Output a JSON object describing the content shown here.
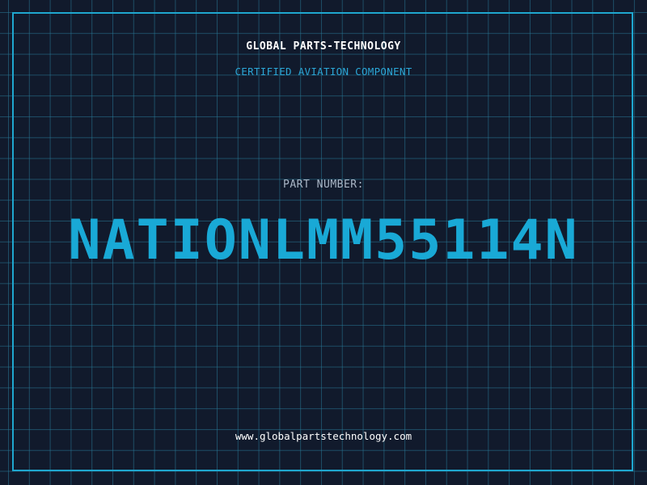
{
  "header": {
    "company_name": "GLOBAL PARTS-TECHNOLOGY",
    "tagline": "CERTIFIED AVIATION COMPONENT"
  },
  "part": {
    "label": "PART NUMBER:",
    "number": "NATIONLMM55114N"
  },
  "footer": {
    "website": "www.globalpartstechnology.com"
  },
  "colors": {
    "background": "#111a2c",
    "grid": "#287896",
    "frame": "#1fa7cf",
    "accent": "#19a9d6"
  }
}
